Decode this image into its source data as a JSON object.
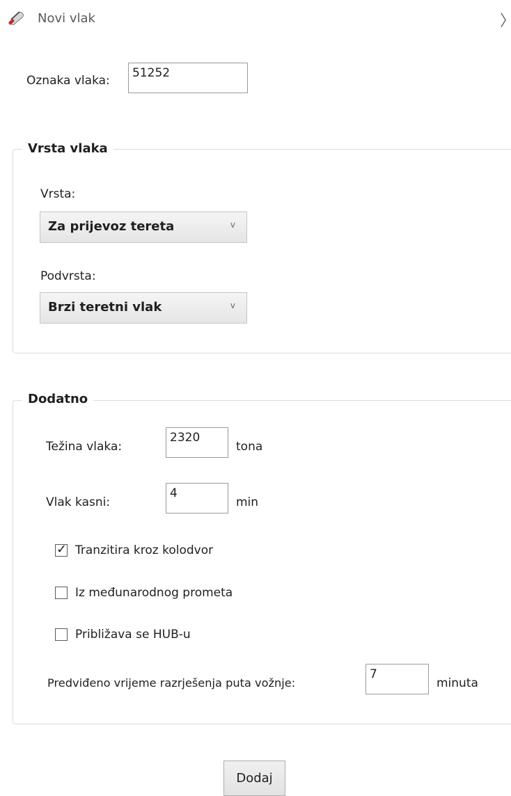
{
  "window": {
    "title": "Novi vlak",
    "close_glyph": "〉",
    "icon": "train-icon"
  },
  "oznaka": {
    "label": "Oznaka vlaka:",
    "value": "51252"
  },
  "vrsta_group": {
    "title": "Vrsta vlaka",
    "vrsta_label": "Vrsta:",
    "vrsta_value": "Za prijevoz tereta",
    "podvrsta_label": "Podvrsta:",
    "podvrsta_value": "Brzi teretni vlak",
    "chevron": "v"
  },
  "dodatno_group": {
    "title": "Dodatno",
    "tezina_label": "Težina vlaka:",
    "tezina_value": "2320",
    "tezina_unit": "tona",
    "kasni_label": "Vlak kasni:",
    "kasni_value": "4",
    "kasni_unit": "min",
    "checkboxes": [
      {
        "label": "Tranzitira kroz kolodvor",
        "checked": true,
        "mark": "✓"
      },
      {
        "label": "Iz međunarodnog prometa",
        "checked": false
      },
      {
        "label": "Približava se HUB-u",
        "checked": false
      }
    ],
    "vrijeme_label": "Predviđeno vrijeme razrješenja puta vožnje:",
    "vrijeme_value": "7",
    "vrijeme_unit": "minuta"
  },
  "actions": {
    "add_label": "Dodaj"
  }
}
